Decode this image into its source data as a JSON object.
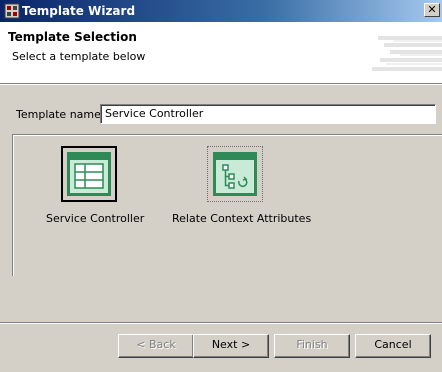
{
  "window": {
    "title": "Template Wizard",
    "close_glyph": "✕"
  },
  "header": {
    "heading": "Template Selection",
    "subheading": "Select a template below"
  },
  "form": {
    "name_label": "Template name:",
    "name_value": "Service Controller"
  },
  "templates": [
    {
      "label": "Service Controller",
      "icon": "service-controller-icon",
      "selected": true
    },
    {
      "label": "Relate Context Attributes",
      "icon": "relate-context-attributes-icon",
      "selected": false
    }
  ],
  "buttons": {
    "back": "< Back",
    "next": "Next >",
    "finish": "Finish",
    "cancel": "Cancel"
  },
  "colors": {
    "title_bar": "#0a246a",
    "dialog_bg": "#d4d0c8",
    "icon_green": "#2e8b57"
  }
}
